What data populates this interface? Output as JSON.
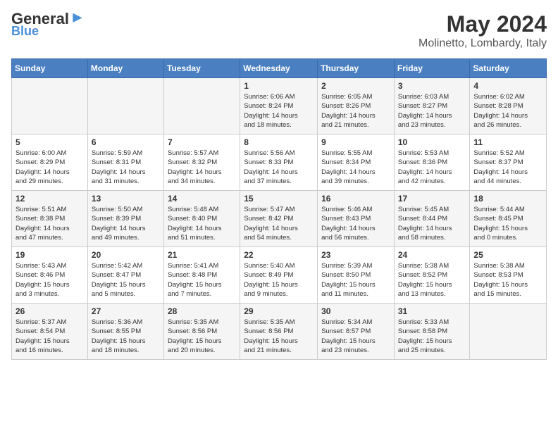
{
  "header": {
    "logo_general": "General",
    "logo_blue": "Blue",
    "month_year": "May 2024",
    "location": "Molinetto, Lombardy, Italy"
  },
  "weekdays": [
    "Sunday",
    "Monday",
    "Tuesday",
    "Wednesday",
    "Thursday",
    "Friday",
    "Saturday"
  ],
  "weeks": [
    [
      {
        "day": "",
        "info": ""
      },
      {
        "day": "",
        "info": ""
      },
      {
        "day": "",
        "info": ""
      },
      {
        "day": "1",
        "info": "Sunrise: 6:06 AM\nSunset: 8:24 PM\nDaylight: 14 hours\nand 18 minutes."
      },
      {
        "day": "2",
        "info": "Sunrise: 6:05 AM\nSunset: 8:26 PM\nDaylight: 14 hours\nand 21 minutes."
      },
      {
        "day": "3",
        "info": "Sunrise: 6:03 AM\nSunset: 8:27 PM\nDaylight: 14 hours\nand 23 minutes."
      },
      {
        "day": "4",
        "info": "Sunrise: 6:02 AM\nSunset: 8:28 PM\nDaylight: 14 hours\nand 26 minutes."
      }
    ],
    [
      {
        "day": "5",
        "info": "Sunrise: 6:00 AM\nSunset: 8:29 PM\nDaylight: 14 hours\nand 29 minutes."
      },
      {
        "day": "6",
        "info": "Sunrise: 5:59 AM\nSunset: 8:31 PM\nDaylight: 14 hours\nand 31 minutes."
      },
      {
        "day": "7",
        "info": "Sunrise: 5:57 AM\nSunset: 8:32 PM\nDaylight: 14 hours\nand 34 minutes."
      },
      {
        "day": "8",
        "info": "Sunrise: 5:56 AM\nSunset: 8:33 PM\nDaylight: 14 hours\nand 37 minutes."
      },
      {
        "day": "9",
        "info": "Sunrise: 5:55 AM\nSunset: 8:34 PM\nDaylight: 14 hours\nand 39 minutes."
      },
      {
        "day": "10",
        "info": "Sunrise: 5:53 AM\nSunset: 8:36 PM\nDaylight: 14 hours\nand 42 minutes."
      },
      {
        "day": "11",
        "info": "Sunrise: 5:52 AM\nSunset: 8:37 PM\nDaylight: 14 hours\nand 44 minutes."
      }
    ],
    [
      {
        "day": "12",
        "info": "Sunrise: 5:51 AM\nSunset: 8:38 PM\nDaylight: 14 hours\nand 47 minutes."
      },
      {
        "day": "13",
        "info": "Sunrise: 5:50 AM\nSunset: 8:39 PM\nDaylight: 14 hours\nand 49 minutes."
      },
      {
        "day": "14",
        "info": "Sunrise: 5:48 AM\nSunset: 8:40 PM\nDaylight: 14 hours\nand 51 minutes."
      },
      {
        "day": "15",
        "info": "Sunrise: 5:47 AM\nSunset: 8:42 PM\nDaylight: 14 hours\nand 54 minutes."
      },
      {
        "day": "16",
        "info": "Sunrise: 5:46 AM\nSunset: 8:43 PM\nDaylight: 14 hours\nand 56 minutes."
      },
      {
        "day": "17",
        "info": "Sunrise: 5:45 AM\nSunset: 8:44 PM\nDaylight: 14 hours\nand 58 minutes."
      },
      {
        "day": "18",
        "info": "Sunrise: 5:44 AM\nSunset: 8:45 PM\nDaylight: 15 hours\nand 0 minutes."
      }
    ],
    [
      {
        "day": "19",
        "info": "Sunrise: 5:43 AM\nSunset: 8:46 PM\nDaylight: 15 hours\nand 3 minutes."
      },
      {
        "day": "20",
        "info": "Sunrise: 5:42 AM\nSunset: 8:47 PM\nDaylight: 15 hours\nand 5 minutes."
      },
      {
        "day": "21",
        "info": "Sunrise: 5:41 AM\nSunset: 8:48 PM\nDaylight: 15 hours\nand 7 minutes."
      },
      {
        "day": "22",
        "info": "Sunrise: 5:40 AM\nSunset: 8:49 PM\nDaylight: 15 hours\nand 9 minutes."
      },
      {
        "day": "23",
        "info": "Sunrise: 5:39 AM\nSunset: 8:50 PM\nDaylight: 15 hours\nand 11 minutes."
      },
      {
        "day": "24",
        "info": "Sunrise: 5:38 AM\nSunset: 8:52 PM\nDaylight: 15 hours\nand 13 minutes."
      },
      {
        "day": "25",
        "info": "Sunrise: 5:38 AM\nSunset: 8:53 PM\nDaylight: 15 hours\nand 15 minutes."
      }
    ],
    [
      {
        "day": "26",
        "info": "Sunrise: 5:37 AM\nSunset: 8:54 PM\nDaylight: 15 hours\nand 16 minutes."
      },
      {
        "day": "27",
        "info": "Sunrise: 5:36 AM\nSunset: 8:55 PM\nDaylight: 15 hours\nand 18 minutes."
      },
      {
        "day": "28",
        "info": "Sunrise: 5:35 AM\nSunset: 8:56 PM\nDaylight: 15 hours\nand 20 minutes."
      },
      {
        "day": "29",
        "info": "Sunrise: 5:35 AM\nSunset: 8:56 PM\nDaylight: 15 hours\nand 21 minutes."
      },
      {
        "day": "30",
        "info": "Sunrise: 5:34 AM\nSunset: 8:57 PM\nDaylight: 15 hours\nand 23 minutes."
      },
      {
        "day": "31",
        "info": "Sunrise: 5:33 AM\nSunset: 8:58 PM\nDaylight: 15 hours\nand 25 minutes."
      },
      {
        "day": "",
        "info": ""
      }
    ]
  ]
}
